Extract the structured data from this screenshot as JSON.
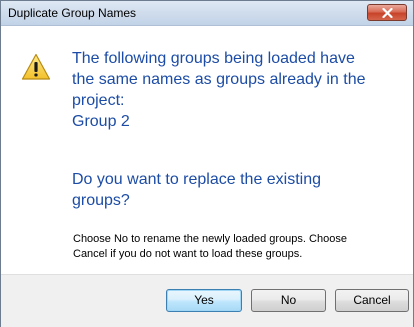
{
  "dialog": {
    "title": "Duplicate Group Names",
    "close_icon": "close-icon",
    "warning_icon": "warning-icon",
    "message_lines": [
      "The following groups being loaded have",
      "the same names as groups already in the",
      "project:",
      "Group 2"
    ],
    "question": "Do you want to replace the existing groups?",
    "detail_lines": [
      "Choose No to rename the newly loaded groups. Choose",
      "Cancel if you do not want to load these groups."
    ],
    "buttons": {
      "yes": "Yes",
      "no": "No",
      "cancel": "Cancel"
    }
  },
  "colors": {
    "instruction_text": "#1c4ca5",
    "close_button": "#c7442a",
    "footer_background": "#f0f0f0"
  }
}
